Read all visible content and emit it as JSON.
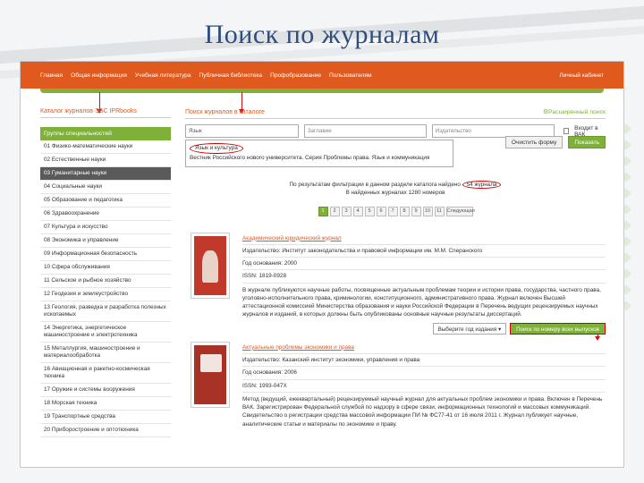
{
  "slide": {
    "title": "Поиск по журналам"
  },
  "nav": {
    "items": [
      "Главная",
      "Общая информация",
      "Учебная литература",
      "Публичная библиотека",
      "Профобразование",
      "Пользователям"
    ],
    "right": "Личный кабинет"
  },
  "sidebar": {
    "title": "Каталог журналов ЭБС IPRbooks",
    "header": "Группы специальностей",
    "items": [
      "01 Физико-математические науки",
      "02 Естественные науки",
      "03 Гуманитарные науки",
      "04 Социальные науки",
      "05 Образование и педагогика",
      "06 Здравоохранение",
      "07 Культура и искусство",
      "08 Экономика и управление",
      "09 Информационная безопасность",
      "10 Сфера обслуживания",
      "11 Сельское и рыбное хозяйство",
      "12 Геодезия и землеустройство",
      "13 Геология, разведка и разработка полезных ископаемых",
      "14 Энергетика, энергетическое машиностроение и электротехника",
      "15 Металлургия, машиностроение и материалообработка",
      "16 Авиационная и ракетно-космическая техника",
      "17 Оружие и системы вооружения",
      "18 Морская техника",
      "19 Транспортные средства",
      "20 Приборостроение и оптотехника"
    ]
  },
  "main": {
    "title": "Поиск журналов в каталоге",
    "advanced_link": "Расширенный поиск",
    "search_value": "Язык",
    "field2_placeholder": "Заглавие",
    "field3_placeholder": "Издательство",
    "vak_label": "Входит в ВАК",
    "clear_button": "Очистить форму",
    "search_button": "Показать",
    "suggest_selected": "Язык и культура",
    "suggest_other": "Вестник Российского нового университета. Серия Проблемы права. Язык и коммуникация",
    "result_line1": "По результатам фильтрации в данном разделе каталога найдено",
    "result_count": "54 журнала",
    "result_line2": "В найденных журналах 1280 номеров",
    "pages": [
      "1",
      "2",
      "3",
      "4",
      "5",
      "6",
      "7",
      "8",
      "9",
      "10",
      "11"
    ],
    "next_label": "Следующая"
  },
  "journals": [
    {
      "title": "Академический юридический журнал",
      "publisher": "Издательство: Институт законодательства и правовой информации им. М.М. Сперанского",
      "year": "Год основания: 2000",
      "issn": "ISSN: 1819-0928",
      "description": "В журнале публикуются научные работы, посвященные актуальным проблемам теории и истории права, государства, частного права, уголовно-исполнительного права, криминологии, конституционного, административного права. Журнал включен Высшей аттестационной комиссией Министерства образования и науки Российской Федерации в Перечень ведущих рецензируемых научных журналов и изданий, в которых должны быть опубликованы основные научные результаты диссертаций.",
      "select_label": "Выберите год издания",
      "go_label": "Поиск по номеру всех выпусков"
    },
    {
      "title": "Актуальные проблемы экономики и права",
      "publisher": "Издательство: Казанский институт экономики, управления и права",
      "year": "Год основания: 2006",
      "issn": "ISSN: 1993-047X",
      "description": "Метод (ведущий, ежеквартальный) рецензируемый научный журнал для актуальных проблем экономики и права. Включен в Перечень ВАК. Зарегистрирован Федеральной службой по надзору в сфере связи, информационных технологий и массовых коммуникаций. Свидетельство о регистрации средства массовой информации ПИ № ФС77-41 от 16 июля 2011 г. Журнал публикует научные, аналитические статьи и материалы по экономике и праву."
    }
  ]
}
